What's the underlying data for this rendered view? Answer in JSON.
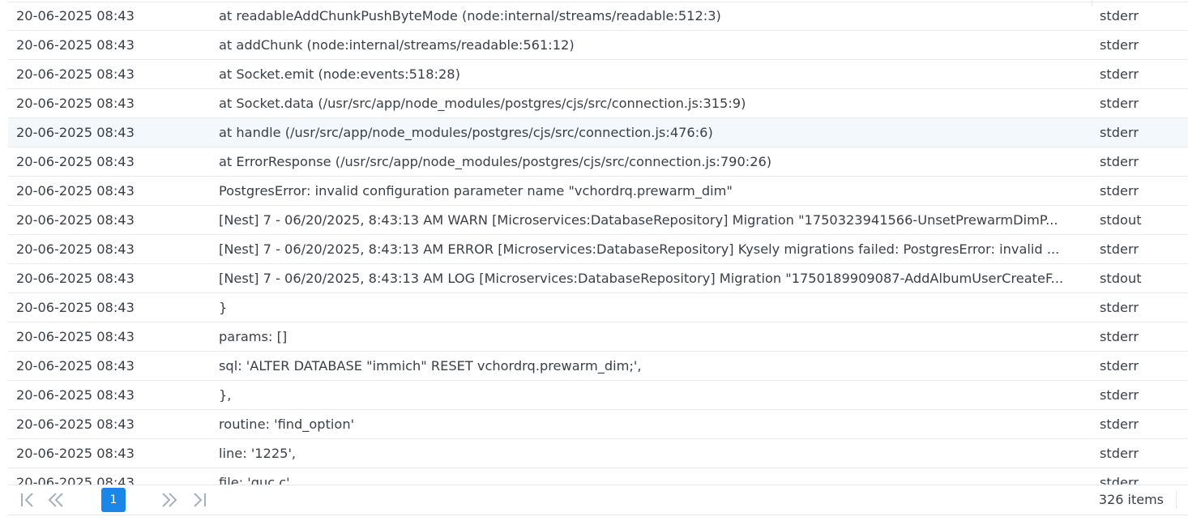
{
  "log_rows": [
    {
      "time": "20-06-2025 08:43",
      "message": "at readableAddChunkPushByteMode (node:internal/streams/readable:512:3)",
      "stream": "stderr"
    },
    {
      "time": "20-06-2025 08:43",
      "message": "at addChunk (node:internal/streams/readable:561:12)",
      "stream": "stderr"
    },
    {
      "time": "20-06-2025 08:43",
      "message": "at Socket.emit (node:events:518:28)",
      "stream": "stderr"
    },
    {
      "time": "20-06-2025 08:43",
      "message": "at Socket.data (/usr/src/app/node_modules/postgres/cjs/src/connection.js:315:9)",
      "stream": "stderr"
    },
    {
      "time": "20-06-2025 08:43",
      "message": "at handle (/usr/src/app/node_modules/postgres/cjs/src/connection.js:476:6)",
      "stream": "stderr"
    },
    {
      "time": "20-06-2025 08:43",
      "message": "at ErrorResponse (/usr/src/app/node_modules/postgres/cjs/src/connection.js:790:26)",
      "stream": "stderr"
    },
    {
      "time": "20-06-2025 08:43",
      "message": "PostgresError: invalid configuration parameter name \"vchordrq.prewarm_dim\"",
      "stream": "stderr"
    },
    {
      "time": "20-06-2025 08:43",
      "message": "[Nest] 7 - 06/20/2025, 8:43:13 AM WARN [Microservices:DatabaseRepository] Migration \"1750323941566-UnsetPrewarmDimP...",
      "stream": "stdout"
    },
    {
      "time": "20-06-2025 08:43",
      "message": "[Nest] 7 - 06/20/2025, 8:43:13 AM ERROR [Microservices:DatabaseRepository] Kysely migrations failed: PostgresError: invalid ...",
      "stream": "stderr"
    },
    {
      "time": "20-06-2025 08:43",
      "message": "[Nest] 7 - 06/20/2025, 8:43:13 AM LOG [Microservices:DatabaseRepository] Migration \"1750189909087-AddAlbumUserCreateF...",
      "stream": "stdout"
    },
    {
      "time": "20-06-2025 08:43",
      "message": "}",
      "stream": "stderr"
    },
    {
      "time": "20-06-2025 08:43",
      "message": "params: []",
      "stream": "stderr"
    },
    {
      "time": "20-06-2025 08:43",
      "message": "sql: 'ALTER DATABASE \"immich\" RESET vchordrq.prewarm_dim;',",
      "stream": "stderr"
    },
    {
      "time": "20-06-2025 08:43",
      "message": "},",
      "stream": "stderr"
    },
    {
      "time": "20-06-2025 08:43",
      "message": "routine: 'find_option'",
      "stream": "stderr"
    },
    {
      "time": "20-06-2025 08:43",
      "message": "line: '1225',",
      "stream": "stderr"
    },
    {
      "time": "20-06-2025 08:43",
      "message": "file: 'guc.c',",
      "stream": "stderr"
    }
  ],
  "hovered_row_index": 4,
  "pagination": {
    "current_page": "1",
    "items_count": "326 items",
    "icons": [
      "first-page-icon",
      "previous-page-icon",
      "next-page-icon",
      "last-page-icon"
    ]
  },
  "colors": {
    "accent": "#1a86e8",
    "row_hover": "#f3f8fd",
    "text": "#3a3f47",
    "icon_muted": "#a7afba"
  }
}
